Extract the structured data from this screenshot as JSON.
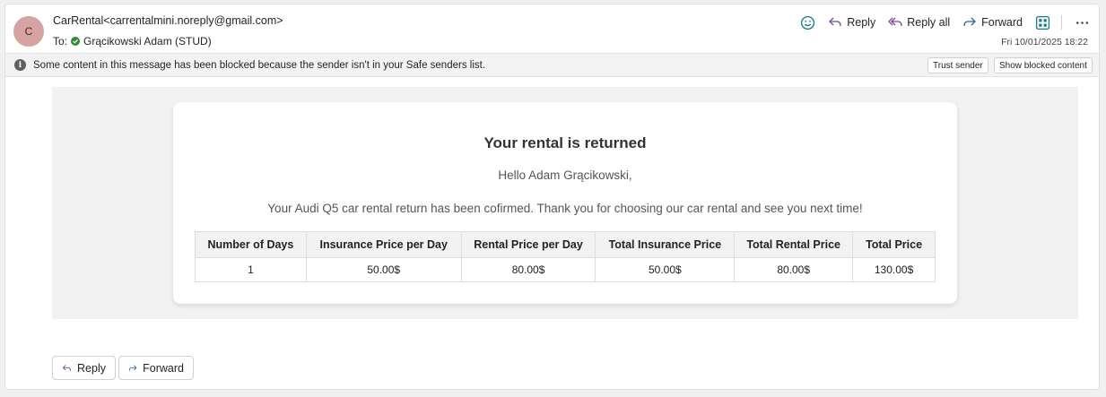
{
  "header": {
    "avatar_initial": "C",
    "sender": "CarRental<carrentalmini.noreply@gmail.com>",
    "to_label": "To:",
    "recipient": "Grącikowski Adam (STUD)",
    "date": "Fri 10/01/2025 18:22",
    "actions": {
      "reply": "Reply",
      "reply_all": "Reply all",
      "forward": "Forward"
    }
  },
  "infobar": {
    "text": "Some content in this message has been blocked because the sender isn't in your Safe senders list.",
    "trust_label": "Trust sender",
    "show_label": "Show blocked content"
  },
  "email": {
    "title": "Your rental is returned",
    "greeting": "Hello Adam Grącikowski,",
    "message": "Your Audi Q5 car rental return has been cofirmed. Thank you for choosing our car rental and see you next time!",
    "table": {
      "headers": [
        "Number of Days",
        "Insurance Price per Day",
        "Rental Price per Day",
        "Total Insurance Price",
        "Total Rental Price",
        "Total Price"
      ],
      "row": [
        "1",
        "50.00$",
        "80.00$",
        "50.00$",
        "80.00$",
        "130.00$"
      ]
    }
  },
  "footer": {
    "reply": "Reply",
    "forward": "Forward"
  },
  "colors": {
    "accent": "#6b3fa0",
    "avatar_bg": "#d6a2a2",
    "verified": "#2f8f2f"
  }
}
